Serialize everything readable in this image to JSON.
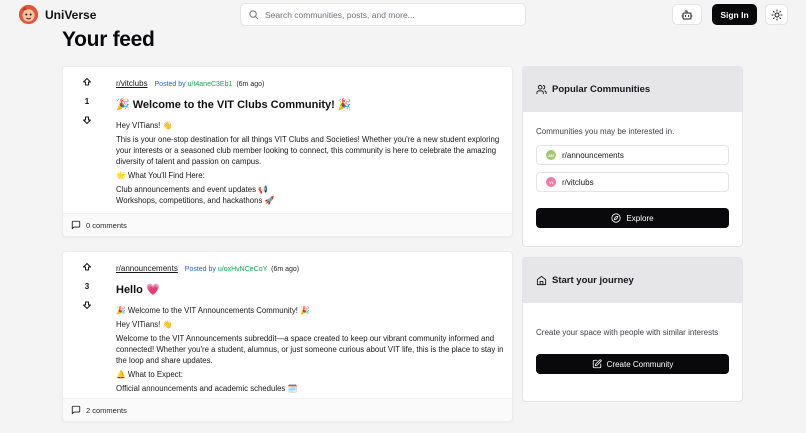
{
  "app": {
    "name": "UniVerse"
  },
  "search": {
    "placeholder": "Search communities, posts, and more..."
  },
  "header": {
    "signin_label": "Sign In"
  },
  "feed": {
    "title": "Your feed",
    "posts": [
      {
        "subreddit": "r/vitclubs",
        "posted_by_prefix": "Posted by",
        "user": "u/t4aneC3Eb1",
        "time": "(6m ago)",
        "votes": "1",
        "title": "🎉 Welcome to the VIT Clubs Community! 🎉",
        "body": [
          "Hey VITians! 👋",
          "This is your one-stop destination for all things VIT Clubs and Societies! Whether you're a new student exploring your interests or a seasoned club member looking to connect, this community is here to celebrate the amazing diversity of talent and passion on campus.",
          "🌟 What You'll Find Here:",
          "Club announcements and event updates 📢\nWorkshops, competitions, and hackathons 🚀"
        ],
        "comments": "0 comments"
      },
      {
        "subreddit": "r/announcements",
        "posted_by_prefix": "Posted by",
        "user": "u/oxHvNCeCoY",
        "time": "(6m ago)",
        "votes": "3",
        "title": "Hello 💗",
        "body": [
          "🎉 Welcome to the VIT Announcements Community! 🎉",
          "Hey VITians! 👋",
          "Welcome to the VIT Announcements subreddit—a space created to keep our vibrant community informed and connected! Whether you're a student, alumnus, or just someone curious about VIT life, this is the place to stay in the loop and share updates.",
          "🔔 What to Expect:",
          "Official announcements and academic schedules 🗓️"
        ],
        "comments": "2 comments"
      }
    ]
  },
  "sidebar": {
    "popular": {
      "title": "Popular Communities",
      "description": "Communities you may be interested in.",
      "communities": [
        {
          "avatar": "AN",
          "name": "r/announcements",
          "color": "#a3c66f"
        },
        {
          "avatar": "VI",
          "name": "r/vitclubs",
          "color": "#f07ca4"
        }
      ],
      "button_label": "Explore"
    },
    "journey": {
      "title": "Start your journey",
      "description": "Create your space with people with similar interests",
      "button_label": "Create Community"
    }
  },
  "icons": {
    "logo": "mascot-logo-icon",
    "search": "search-icon",
    "bot": "bot-icon",
    "theme": "sun-icon",
    "upvote": "arrow-up-icon",
    "downvote": "arrow-down-icon",
    "comment": "message-square-icon",
    "users": "users-icon",
    "home": "home-icon",
    "compass": "compass-icon",
    "edit": "square-pen-icon"
  }
}
